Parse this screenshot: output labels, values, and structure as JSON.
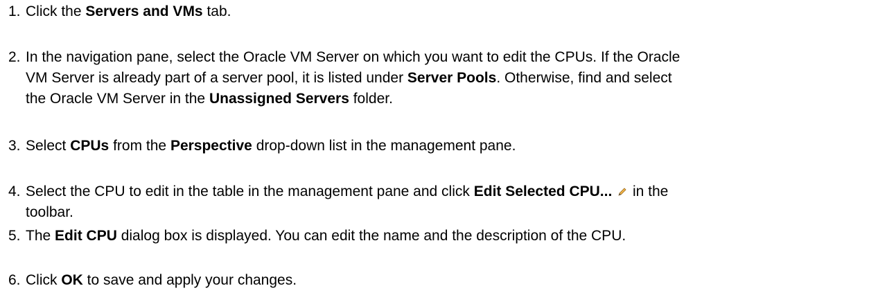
{
  "steps": [
    {
      "number": "1.",
      "lines": [
        [
          {
            "t": "Click the "
          },
          {
            "t": "Servers and VMs",
            "b": true
          },
          {
            "t": " tab."
          }
        ]
      ]
    },
    {
      "number": "2.",
      "lines": [
        [
          {
            "t": "In the navigation pane, select the Oracle VM Server on which you want to edit the CPUs. If the Oracle"
          }
        ],
        [
          {
            "t": "VM Server is already part of a server pool, it is listed under "
          },
          {
            "t": "Server Pools",
            "b": true
          },
          {
            "t": ". Otherwise, find and select"
          }
        ],
        [
          {
            "t": "the Oracle VM Server in the "
          },
          {
            "t": "Unassigned Servers",
            "b": true
          },
          {
            "t": " folder."
          }
        ]
      ]
    },
    {
      "number": "3.",
      "lines": [
        [
          {
            "t": "Select "
          },
          {
            "t": "CPUs",
            "b": true
          },
          {
            "t": " from the "
          },
          {
            "t": "Perspective",
            "b": true
          },
          {
            "t": " drop-down list in the management pane."
          }
        ]
      ]
    },
    {
      "number": "4.",
      "lines": [
        [
          {
            "t": "Select the CPU to edit in the table in the management pane and click "
          },
          {
            "t": "Edit Selected CPU...",
            "b": true
          },
          {
            "t": " "
          },
          {
            "icon": "pencil-icon"
          },
          {
            "t": " in the"
          }
        ],
        [
          {
            "t": "toolbar."
          }
        ]
      ]
    },
    {
      "number": "5.",
      "lines": [
        [
          {
            "t": "The "
          },
          {
            "t": "Edit CPU",
            "b": true
          },
          {
            "t": " dialog box is displayed. You can edit the name and the description of the CPU."
          }
        ]
      ]
    },
    {
      "number": "6.",
      "lines": [
        [
          {
            "t": "Click "
          },
          {
            "t": "OK",
            "b": true
          },
          {
            "t": " to save and apply your changes."
          }
        ]
      ]
    }
  ]
}
